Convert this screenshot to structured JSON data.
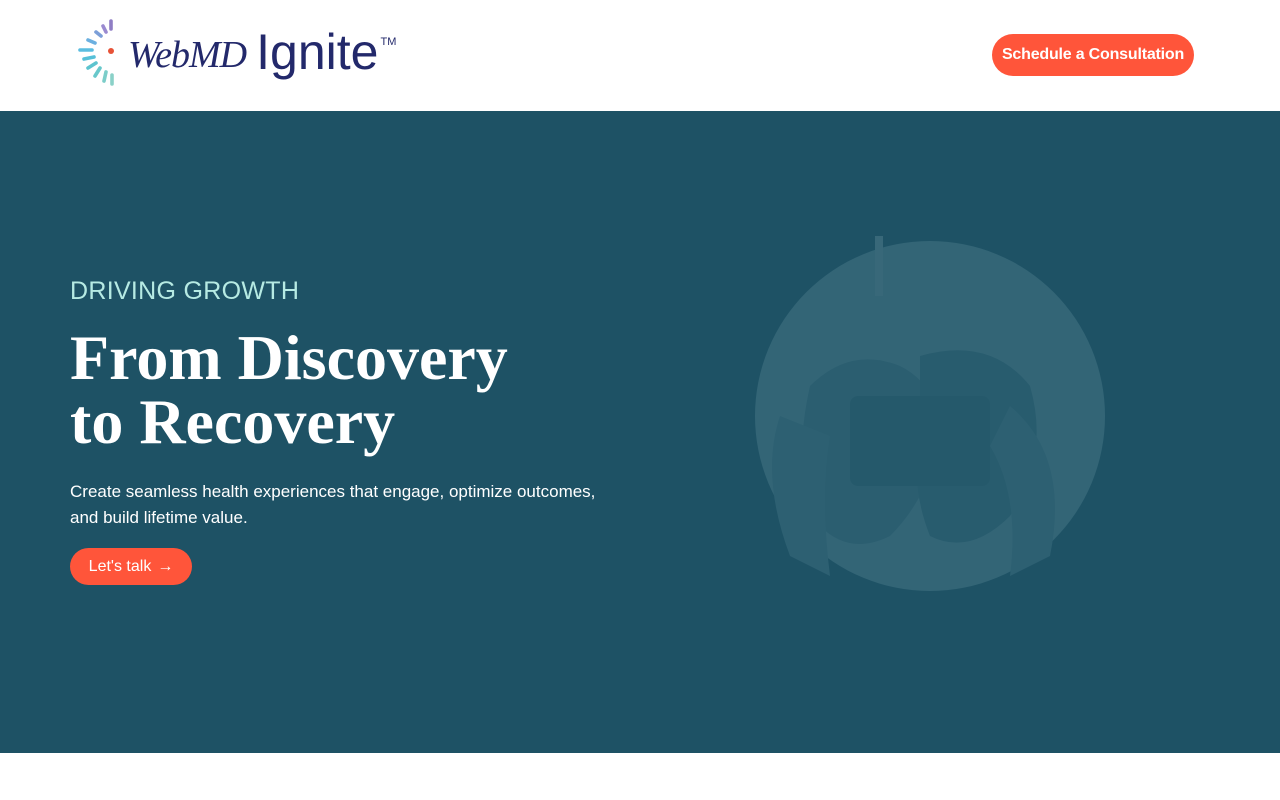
{
  "header": {
    "logo": {
      "brand_part1": "WebMD",
      "brand_part2": "Ignite",
      "trademark": "TM"
    },
    "cta_label": "Schedule a Consultation"
  },
  "hero": {
    "eyebrow": "DRIVING GROWTH",
    "headline_line1": "From Discovery",
    "headline_line2": "to Recovery",
    "subtext_line1": "Create seamless health experiences that engage, optimize outcomes,",
    "subtext_line2": "and build lifetime value.",
    "button_label": "Let's talk",
    "button_arrow": "→",
    "image_icon": "hands-holding-tablet-illustration"
  },
  "colors": {
    "hero_bg": "#1e5265",
    "accent": "#ff553a",
    "eyebrow": "#b6eae3",
    "brand_navy": "#23296b"
  }
}
